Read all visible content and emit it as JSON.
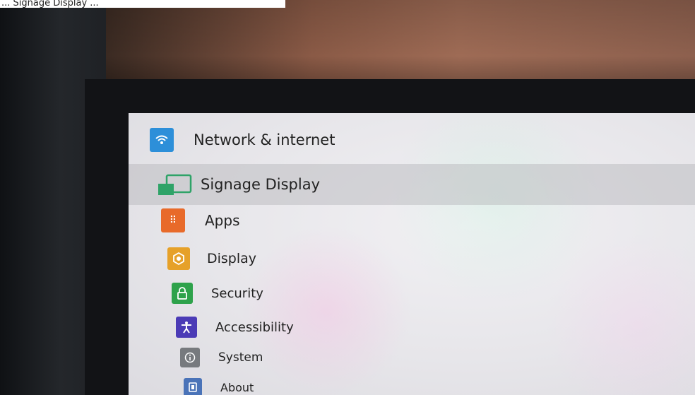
{
  "caption": "... Signage Display ...",
  "menu": {
    "items": [
      {
        "key": "network",
        "label": "Network & internet",
        "icon": "wifi-icon",
        "color": "#2d8fd9"
      },
      {
        "key": "signage",
        "label": "Signage Display",
        "icon": "cast-icon",
        "color": "#2fa368"
      },
      {
        "key": "apps",
        "label": "Apps",
        "icon": "apps-grid-icon",
        "color": "#e86a2a"
      },
      {
        "key": "display",
        "label": "Display",
        "icon": "brightness-icon",
        "color": "#e6a129"
      },
      {
        "key": "security",
        "label": "Security",
        "icon": "lock-icon",
        "color": "#2ea24b"
      },
      {
        "key": "accessibility",
        "label": "Accessibility",
        "icon": "accessibility-icon",
        "color": "#4b3bb6"
      },
      {
        "key": "system",
        "label": "System",
        "icon": "info-icon",
        "color": "#777a7e"
      },
      {
        "key": "about",
        "label": "About",
        "icon": "device-icon",
        "color": "#4a73b8"
      }
    ]
  }
}
